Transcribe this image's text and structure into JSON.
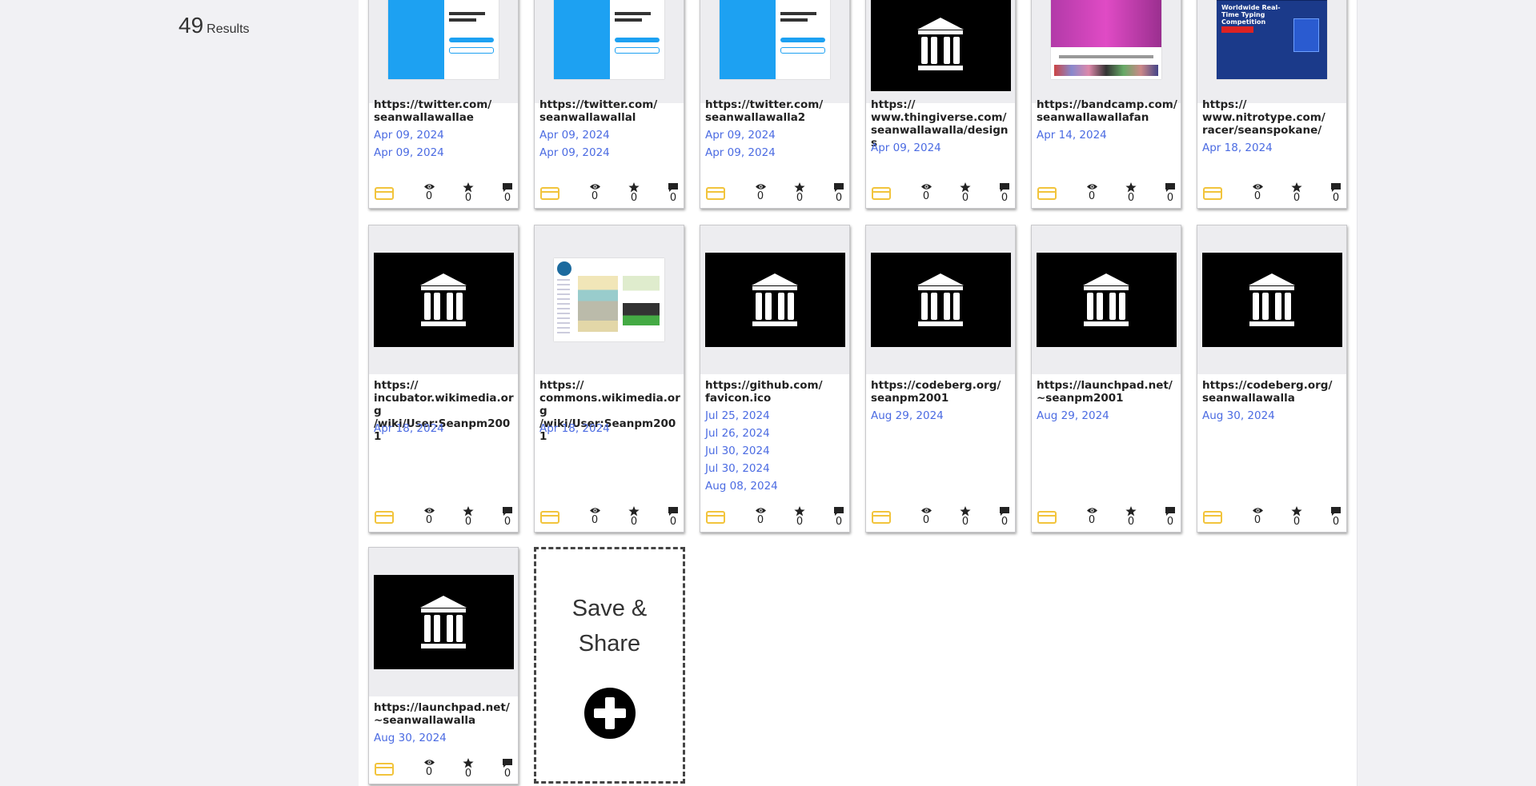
{
  "results": {
    "count": "49",
    "label": "Results"
  },
  "save_card": {
    "label_line1": "Save &",
    "label_line2": "Share"
  },
  "colors": {
    "link_date": "#4b6be2",
    "folder": "#f2c43c",
    "twitter_blue": "#1da1f2"
  },
  "cards": [
    {
      "url": "https://twitter.com/ seanwallawallae",
      "dates": [
        "Apr 09, 2024",
        "Apr 09, 2024"
      ],
      "thumb": "twitter",
      "stats": {
        "views": "0",
        "stars": "0",
        "comments": "0"
      }
    },
    {
      "url": "https://twitter.com/ seanwallawallal",
      "dates": [
        "Apr 09, 2024",
        "Apr 09, 2024"
      ],
      "thumb": "twitter",
      "stats": {
        "views": "0",
        "stars": "0",
        "comments": "0"
      }
    },
    {
      "url": "https://twitter.com/ seanwallawalla2",
      "dates": [
        "Apr 09, 2024",
        "Apr 09, 2024"
      ],
      "thumb": "twitter",
      "stats": {
        "views": "0",
        "stars": "0",
        "comments": "0"
      }
    },
    {
      "url": "https:// www.thingiverse.com/ seanwallawalla/designs",
      "dates": [
        "Apr 09, 2024"
      ],
      "thumb": "archive",
      "stats": {
        "views": "0",
        "stars": "0",
        "comments": "0"
      }
    },
    {
      "url": "https://bandcamp.com/ seanwallawallafan",
      "dates": [
        "Apr 14, 2024"
      ],
      "thumb": "bandcamp",
      "stats": {
        "views": "0",
        "stars": "0",
        "comments": "0"
      }
    },
    {
      "url": "https:// www.nitrotype.com/ racer/seanspokane/",
      "dates": [
        "Apr 18, 2024"
      ],
      "thumb": "nitrotype",
      "thumb_text": "Worldwide Real-Time Typing Competition",
      "stats": {
        "views": "0",
        "stars": "0",
        "comments": "0"
      }
    },
    {
      "url": "https:// incubator.wikimedia.org /wiki/User:Seanpm2001",
      "dates": [
        "Apr 18, 2024"
      ],
      "thumb": "archive",
      "stats": {
        "views": "0",
        "stars": "0",
        "comments": "0"
      }
    },
    {
      "url": "https:// commons.wikimedia.org /wiki/User:Seanpm2001",
      "dates": [
        "Apr 18, 2024"
      ],
      "thumb": "wikimedia",
      "stats": {
        "views": "0",
        "stars": "0",
        "comments": "0"
      }
    },
    {
      "url": "https://github.com/ favicon.ico",
      "dates": [
        "Jul 25, 2024",
        "Jul 26, 2024",
        "Jul 30, 2024",
        "Jul 30, 2024",
        "Aug 08, 2024"
      ],
      "thumb": "archive",
      "stats": {
        "views": "0",
        "stars": "0",
        "comments": "0"
      }
    },
    {
      "url": "https://codeberg.org/ seanpm2001",
      "dates": [
        "Aug 29, 2024"
      ],
      "thumb": "archive",
      "stats": {
        "views": "0",
        "stars": "0",
        "comments": "0"
      }
    },
    {
      "url": "https://launchpad.net/ ~seanpm2001",
      "dates": [
        "Aug 29, 2024"
      ],
      "thumb": "archive",
      "stats": {
        "views": "0",
        "stars": "0",
        "comments": "0"
      }
    },
    {
      "url": "https://codeberg.org/ seanwallawalla",
      "dates": [
        "Aug 30, 2024"
      ],
      "thumb": "archive",
      "stats": {
        "views": "0",
        "stars": "0",
        "comments": "0"
      }
    },
    {
      "url": "https://launchpad.net/ ~seanwallawalla",
      "dates": [
        "Aug 30, 2024"
      ],
      "thumb": "archive",
      "stats": {
        "views": "0",
        "stars": "0",
        "comments": "0"
      }
    }
  ]
}
